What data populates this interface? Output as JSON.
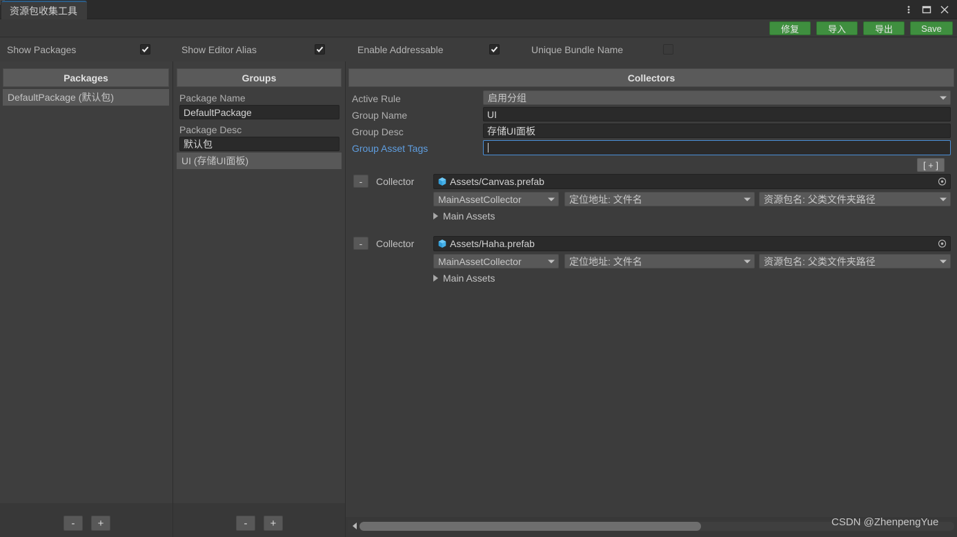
{
  "window": {
    "tab_title": "资源包收集工具",
    "controls": {
      "menu_label": "⋮",
      "maximize_label": "□",
      "close_label": "✕"
    }
  },
  "toolbar": {
    "buttons": [
      {
        "label": "修复",
        "name": "repair-button"
      },
      {
        "label": "导入",
        "name": "import-button"
      },
      {
        "label": "导出",
        "name": "export-button"
      },
      {
        "label": "Save",
        "name": "save-button"
      }
    ]
  },
  "options": [
    {
      "label": "Show Packages",
      "checked": true
    },
    {
      "label": "Show Editor Alias",
      "checked": true
    },
    {
      "label": "Enable Addressable",
      "checked": true
    },
    {
      "label": "Unique Bundle Name",
      "checked": false
    }
  ],
  "packages_panel": {
    "header": "Packages",
    "items": [
      {
        "label": "DefaultPackage (默认包)",
        "selected": true
      }
    ],
    "remove_label": "-",
    "add_label": "+"
  },
  "groups_panel": {
    "header": "Groups",
    "package_name_label": "Package Name",
    "package_name_value": "DefaultPackage",
    "package_desc_label": "Package Desc",
    "package_desc_value": "默认包",
    "items": [
      {
        "label": "UI (存储UI面板)",
        "selected": true
      }
    ],
    "remove_label": "-",
    "add_label": "+"
  },
  "collectors_panel": {
    "header": "Collectors",
    "active_rule_label": "Active Rule",
    "active_rule_value": "启用分组",
    "group_name_label": "Group Name",
    "group_name_value": "UI",
    "group_desc_label": "Group Desc",
    "group_desc_value": "存储UI面板",
    "group_asset_tags_label": "Group Asset Tags",
    "group_asset_tags_value": "",
    "add_collector_label": "[ + ]",
    "collectors": [
      {
        "remove_label": "-",
        "row_label": "Collector",
        "asset_path": "Assets/Canvas.prefab",
        "collector_type": "MainAssetCollector",
        "address_rule": "定位地址: 文件名",
        "pack_rule": "资源包名: 父类文件夹路径",
        "foldout_label": "Main Assets"
      },
      {
        "remove_label": "-",
        "row_label": "Collector",
        "asset_path": "Assets/Haha.prefab",
        "collector_type": "MainAssetCollector",
        "address_rule": "定位地址: 文件名",
        "pack_rule": "资源包名: 父类文件夹路径",
        "foldout_label": "Main Assets"
      }
    ]
  },
  "footer": {
    "watermark": "CSDN @ZhenpengYue"
  },
  "colors": {
    "accent_green": "#3f8f3f",
    "focus_blue": "#4a90d9",
    "tab_active_border": "#2c5d87",
    "panel_header": "#5a5a5a",
    "background": "#383838"
  }
}
